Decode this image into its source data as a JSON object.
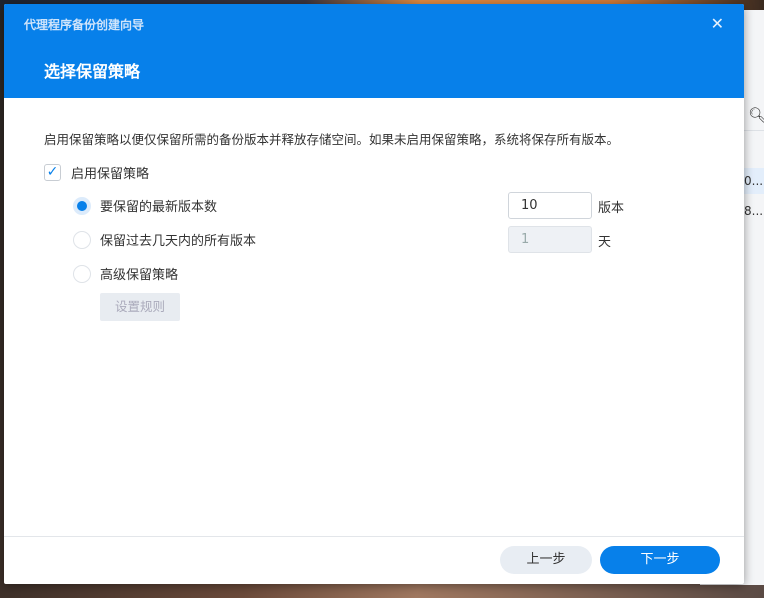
{
  "background_app": {
    "rows": [
      "0...",
      "8..."
    ]
  },
  "dialog": {
    "window_title": "代理程序备份创建向导",
    "step_title": "选择保留策略",
    "description": "启用保留策略以便仅保留所需的备份版本并释放存储空间。如果未启用保留策略，系统将保存所有版本。",
    "enable_checkbox": {
      "label": "启用保留策略",
      "checked": true
    },
    "options": [
      {
        "label": "要保留的最新版本数",
        "selected": true,
        "value": "10",
        "unit": "版本"
      },
      {
        "label": "保留过去几天内的所有版本",
        "selected": false,
        "value": "1",
        "unit": "天"
      },
      {
        "label": "高级保留策略",
        "selected": false
      }
    ],
    "set_rules_label": "设置规则",
    "prev_label": "上一步",
    "next_label": "下一步"
  }
}
